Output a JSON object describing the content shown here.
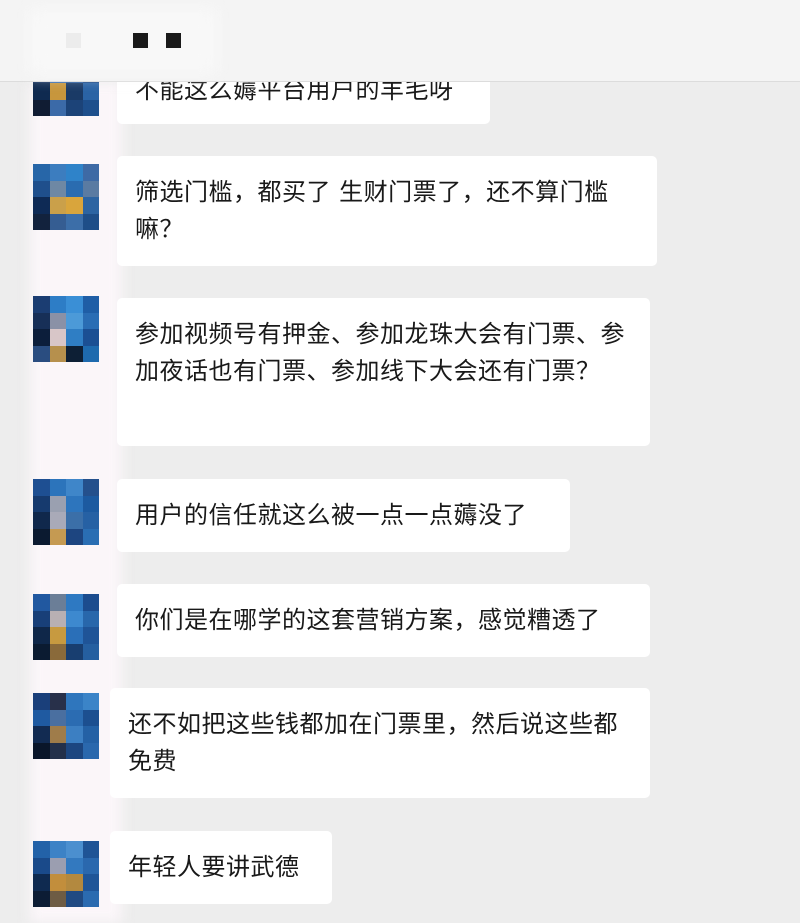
{
  "header": {
    "title_blocks": [
      "gray-square",
      "black-square",
      "black-square"
    ]
  },
  "messages": [
    {
      "text": "不能这么薅平台用户的羊毛呀",
      "partial": true
    },
    {
      "text": "筛选门槛，都买了 生财门票了，还不算门槛嘛？"
    },
    {
      "text": "参加视频号有押金、参加龙珠大会有门票、参加夜话也有门票、参加线下大会还有门票？"
    },
    {
      "text": "用户的信任就这么被一点一点薅没了"
    },
    {
      "text": "你们是在哪学的这套营销方案，感觉糟透了"
    },
    {
      "text": "还不如把这些钱都加在门票里，然后说这些都免费"
    },
    {
      "text": "年轻人要讲武德"
    }
  ],
  "colors": {
    "chat_background": "#ededed",
    "bubble": "#ffffff",
    "text": "#191919",
    "header": "#f4f4f4"
  }
}
